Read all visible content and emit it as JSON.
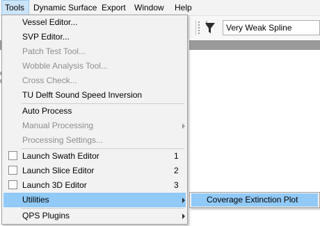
{
  "menubar": {
    "items": [
      {
        "label": "Tools"
      },
      {
        "label": "Dynamic Surface"
      },
      {
        "label": "Export"
      },
      {
        "label": "Window"
      },
      {
        "label": "Help"
      }
    ]
  },
  "toolbar": {
    "filter_combo_value": "Very Weak Spline"
  },
  "tools_menu": {
    "items": {
      "vessel_editor": {
        "label": "Vessel Editor...",
        "enabled": true
      },
      "svp_editor": {
        "label": "SVP Editor...",
        "enabled": true
      },
      "patch_test": {
        "label": "Patch Test Tool...",
        "enabled": false
      },
      "wobble_analysis": {
        "label": "Wobble Analysis Tool...",
        "enabled": false
      },
      "cross_check": {
        "label": "Cross Check...",
        "enabled": false
      },
      "tu_delft": {
        "label": "TU Delft Sound Speed Inversion",
        "enabled": true
      },
      "auto_process": {
        "label": "Auto Process",
        "enabled": true
      },
      "manual_processing": {
        "label": "Manual Processing",
        "enabled": false
      },
      "processing_settings": {
        "label": "Processing Settings...",
        "enabled": false
      },
      "launch_swath": {
        "label": "Launch Swath Editor",
        "shortcut": "1",
        "checked": false
      },
      "launch_slice": {
        "label": "Launch Slice Editor",
        "shortcut": "2",
        "checked": false
      },
      "launch_3d": {
        "label": "Launch 3D Editor",
        "shortcut": "3",
        "checked": false
      },
      "utilities": {
        "label": "Utilities",
        "highlighted": true
      },
      "qps_plugins": {
        "label": "QPS Plugins"
      }
    }
  },
  "utilities_submenu": {
    "items": [
      {
        "label": "Coverage Extinction Plot"
      }
    ]
  },
  "background_peek": {
    "text_a": "o",
    "text_b": "o"
  }
}
